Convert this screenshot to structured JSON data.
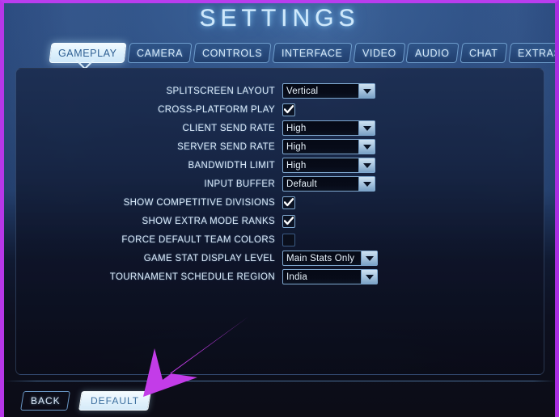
{
  "window": {
    "title": "SETTINGS",
    "accent_color": "#b637e8",
    "background_color": "#24406e"
  },
  "tabs": [
    {
      "label": "GAMEPLAY",
      "active": true
    },
    {
      "label": "CAMERA",
      "active": false
    },
    {
      "label": "CONTROLS",
      "active": false
    },
    {
      "label": "INTERFACE",
      "active": false
    },
    {
      "label": "VIDEO",
      "active": false
    },
    {
      "label": "AUDIO",
      "active": false
    },
    {
      "label": "CHAT",
      "active": false
    },
    {
      "label": "EXTRAS",
      "active": false
    }
  ],
  "settings": [
    {
      "label": "SPLITSCREEN LAYOUT",
      "type": "dropdown",
      "value": "Vertical"
    },
    {
      "label": "CROSS-PLATFORM PLAY",
      "type": "checkbox",
      "checked": true
    },
    {
      "label": "CLIENT SEND RATE",
      "type": "dropdown",
      "value": "High"
    },
    {
      "label": "SERVER SEND RATE",
      "type": "dropdown",
      "value": "High"
    },
    {
      "label": "BANDWIDTH LIMIT",
      "type": "dropdown",
      "value": "High"
    },
    {
      "label": "INPUT BUFFER",
      "type": "dropdown",
      "value": "Default"
    },
    {
      "label": "SHOW COMPETITIVE DIVISIONS",
      "type": "checkbox",
      "checked": true
    },
    {
      "label": "SHOW EXTRA MODE RANKS",
      "type": "checkbox",
      "checked": true
    },
    {
      "label": "FORCE DEFAULT TEAM COLORS",
      "type": "checkbox",
      "checked": false
    },
    {
      "label": "GAME STAT DISPLAY LEVEL",
      "type": "dropdown",
      "value": "Main Stats Only",
      "wide": true
    },
    {
      "label": "TOURNAMENT SCHEDULE REGION",
      "type": "dropdown",
      "value": "India",
      "wide": true
    }
  ],
  "footer": {
    "back_label": "BACK",
    "default_label": "DEFAULT"
  },
  "annotation": {
    "type": "arrow",
    "color": "#c33ce8",
    "points_to": "DEFAULT"
  }
}
